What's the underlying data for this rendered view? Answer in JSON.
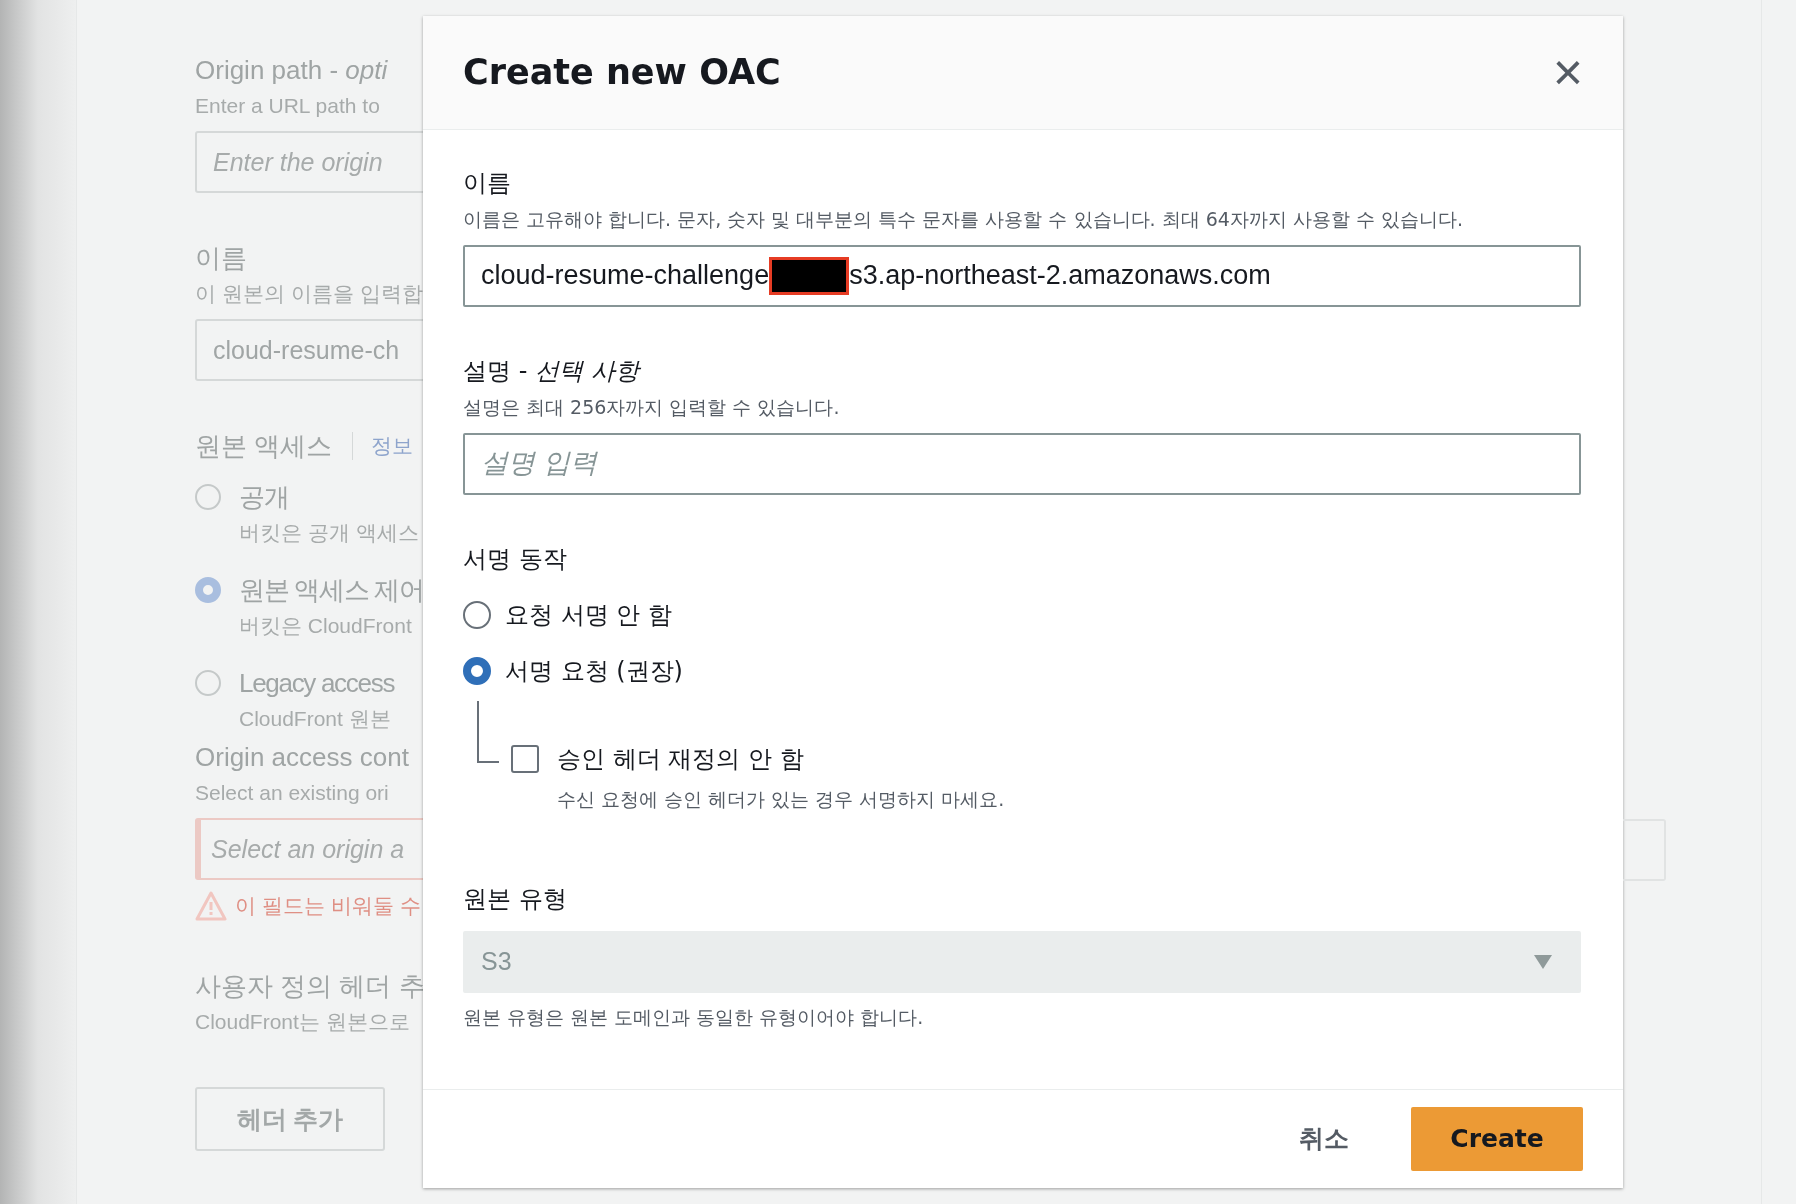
{
  "background_form": {
    "origin_path": {
      "label": "Origin path - *opti*",
      "description": "Enter a URL path to",
      "placeholder": "Enter the origin"
    },
    "name": {
      "label": "이름",
      "description": "이 원본의 이름을 입력합",
      "value": "cloud-resume-ch"
    },
    "origin_access": {
      "label": "원본 액세스",
      "info_link": "정보",
      "options": [
        {
          "label": "공개",
          "description": "버킷은 공개 액세스",
          "selected": false
        },
        {
          "label": "원본 액세스 제어",
          "description": "버킷은 CloudFront",
          "selected": true
        },
        {
          "label": "Legacy access",
          "description": "CloudFront 원본",
          "selected": false
        }
      ]
    },
    "origin_access_control": {
      "label": "Origin access cont",
      "description": "Select an existing ori",
      "placeholder": "Select an origin a",
      "error": "이 필드는 비워둘 수"
    },
    "custom_headers": {
      "label": "사용자 정의 헤더 추",
      "description": "CloudFront는 원본으로",
      "button": "헤더 추가"
    }
  },
  "dialog": {
    "title": "Create new OAC",
    "close": "×",
    "name": {
      "label": "이름",
      "description": "이름은 고유해야 합니다. 문자, 숫자 및 대부분의 특수 문자를 사용할 수 있습니다. 최대 64자까지 사용할 수 있습니다.",
      "value_start": "cloud-resume-challenge",
      "redacted": true,
      "value_end": "s3.ap-northeast-2.amazonaws.com"
    },
    "description": {
      "label": "설명 - *선택 사항*",
      "description": "설명은 최대 256자까지 입력할 수 있습니다.",
      "placeholder": "설명 입력"
    },
    "signing": {
      "label": "서명 동작",
      "options": [
        {
          "label": "요청 서명 안 함",
          "selected": false
        },
        {
          "label": "서명 요청 (권장)",
          "selected": true
        }
      ],
      "override": {
        "label": "승인 헤더 재정의 안 함",
        "description": "수신 요청에 승인 헤더가 있는 경우 서명하지 마세요.",
        "checked": false
      }
    },
    "origin_type": {
      "label": "원본 유형",
      "value": "S3",
      "disabled": true,
      "description": "원본 유형은 원본 도메인과 동일한 유형이어야 합니다."
    },
    "buttons": [
      {
        "label": "취소",
        "kind": "link"
      },
      {
        "label": "Create",
        "kind": "primary"
      }
    ]
  }
}
